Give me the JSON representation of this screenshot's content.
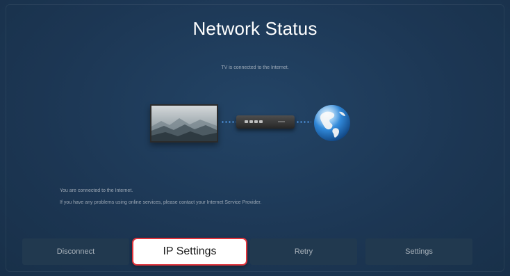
{
  "header": {
    "title": "Network Status",
    "subtitle": "TV is connected to the Internet."
  },
  "diagram": {
    "tv_label": "TV",
    "router_label": "Router",
    "internet_label": "Internet",
    "connection_color": "#5aa9ff"
  },
  "info": {
    "line1": "You are connected to the Internet.",
    "line2": "If you have any problems using online services, please contact your Internet Service Provider."
  },
  "actions": {
    "disconnect": "Disconnect",
    "ip_settings": "IP Settings",
    "retry": "Retry",
    "settings": "Settings",
    "focused": "IP Settings"
  },
  "colors": {
    "background": "#1c3653",
    "button": "#21394f",
    "focus_border": "#e0343c"
  }
}
